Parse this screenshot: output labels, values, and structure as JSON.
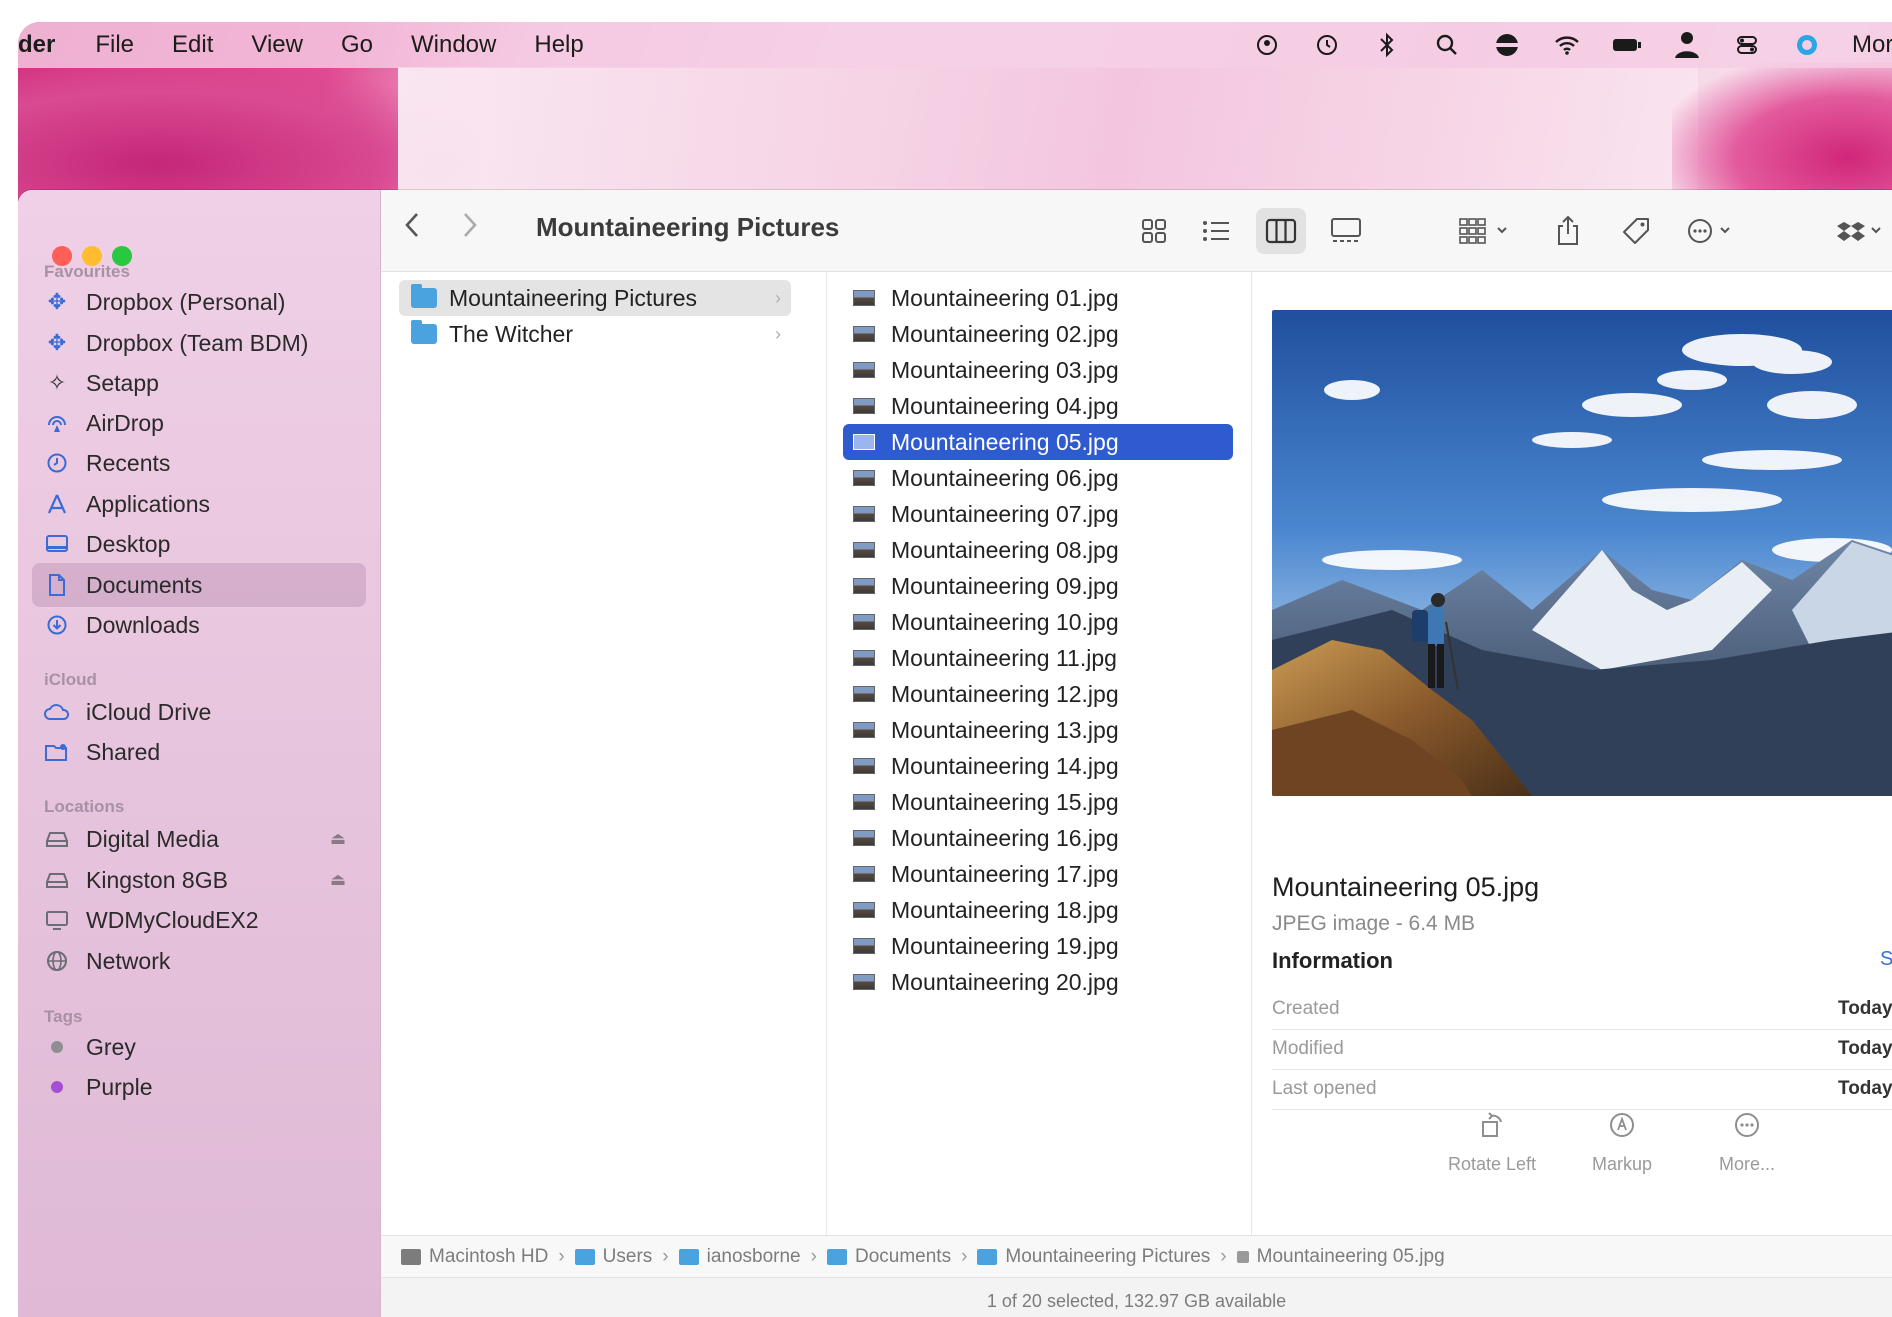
{
  "menubar": {
    "app_name": "der",
    "menus": [
      "File",
      "Edit",
      "View",
      "Go",
      "Window",
      "Help"
    ],
    "status_icons": [
      "user-circle-icon",
      "time-machine-icon",
      "bluetooth-icon",
      "search-icon",
      "vpn-icon",
      "wifi-icon",
      "battery-icon",
      "user-silhouette-icon",
      "control-center-icon",
      "siri-icon"
    ],
    "clock": "Mor"
  },
  "window": {
    "title": "Mountaineering Pictures"
  },
  "sidebar": {
    "sections": {
      "favourites": "Favourites",
      "icloud": "iCloud",
      "locations": "Locations",
      "tags": "Tags"
    },
    "favourites": [
      {
        "label": "Dropbox (Personal)",
        "icon": "dropbox-icon"
      },
      {
        "label": "Dropbox (Team BDM)",
        "icon": "dropbox-icon"
      },
      {
        "label": "Setapp",
        "icon": "setapp-icon"
      },
      {
        "label": "AirDrop",
        "icon": "airdrop-icon"
      },
      {
        "label": "Recents",
        "icon": "clock-icon"
      },
      {
        "label": "Applications",
        "icon": "applications-icon"
      },
      {
        "label": "Desktop",
        "icon": "desktop-icon"
      },
      {
        "label": "Documents",
        "icon": "document-icon",
        "selected": true
      },
      {
        "label": "Downloads",
        "icon": "download-icon"
      }
    ],
    "icloud": [
      {
        "label": "iCloud Drive",
        "icon": "cloud-icon"
      },
      {
        "label": "Shared",
        "icon": "shared-folder-icon"
      }
    ],
    "locations": [
      {
        "label": "Digital Media",
        "icon": "drive-icon",
        "eject": true
      },
      {
        "label": "Kingston 8GB",
        "icon": "drive-icon",
        "eject": true
      },
      {
        "label": "WDMyCloudEX2",
        "icon": "display-icon"
      },
      {
        "label": "Network",
        "icon": "globe-icon"
      }
    ],
    "tags": [
      {
        "label": "Grey",
        "color": "#8e8e93"
      },
      {
        "label": "Purple",
        "color": "#a550d4"
      }
    ]
  },
  "column1": [
    {
      "label": "Mountaineering Pictures",
      "highlight": true
    },
    {
      "label": "The Witcher",
      "highlight": false
    }
  ],
  "files": [
    "Mountaineering 01.jpg",
    "Mountaineering 02.jpg",
    "Mountaineering 03.jpg",
    "Mountaineering 04.jpg",
    "Mountaineering 05.jpg",
    "Mountaineering 06.jpg",
    "Mountaineering 07.jpg",
    "Mountaineering 08.jpg",
    "Mountaineering 09.jpg",
    "Mountaineering 10.jpg",
    "Mountaineering 11.jpg",
    "Mountaineering 12.jpg",
    "Mountaineering 13.jpg",
    "Mountaineering 14.jpg",
    "Mountaineering 15.jpg",
    "Mountaineering 16.jpg",
    "Mountaineering 17.jpg",
    "Mountaineering 18.jpg",
    "Mountaineering 19.jpg",
    "Mountaineering 20.jpg"
  ],
  "selected_file": "Mountaineering 05.jpg",
  "preview": {
    "name": "Mountaineering 05.jpg",
    "kind": "JPEG image - 6.4 MB",
    "info_heading": "Information",
    "show_more": "S",
    "rows": [
      {
        "key": "Created",
        "value": "Today"
      },
      {
        "key": "Modified",
        "value": "Today"
      },
      {
        "key": "Last opened",
        "value": "Today"
      }
    ],
    "actions": [
      {
        "label": "Rotate Left",
        "icon": "rotate-left-icon"
      },
      {
        "label": "Markup",
        "icon": "markup-icon"
      },
      {
        "label": "More...",
        "icon": "more-icon"
      }
    ]
  },
  "pathbar": [
    "Macintosh HD",
    "Users",
    "ianosborne",
    "Documents",
    "Mountaineering Pictures",
    "Mountaineering 05.jpg"
  ],
  "status": "1 of 20 selected, 132.97 GB available",
  "colors": {
    "selection": "#2f5bd1",
    "folder": "#4aa3de",
    "sidebar_accent": "#3a6bd6"
  }
}
